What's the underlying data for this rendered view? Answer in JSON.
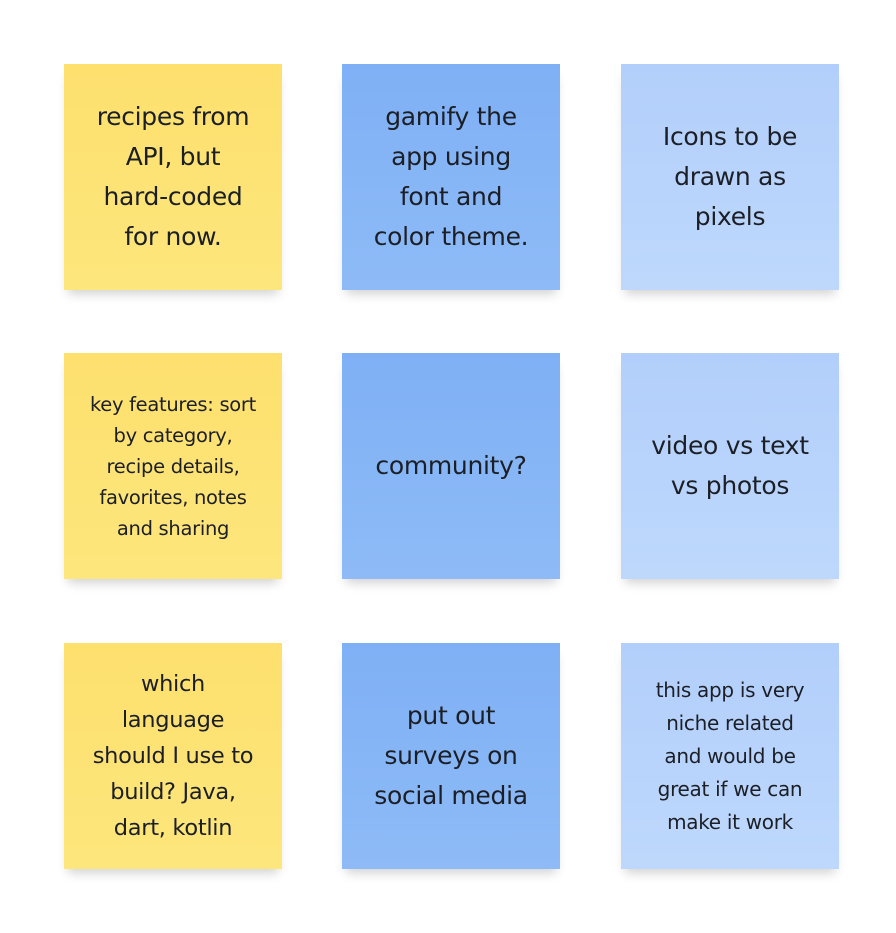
{
  "colors": {
    "yellow": "#fde272",
    "blue": "#86b5f6",
    "light_blue": "#b8d3fb",
    "text": "#1c1f26"
  },
  "notes": [
    {
      "text": "recipes from\nAPI, but\nhard-coded\nfor now.",
      "color": "yellow"
    },
    {
      "text": "gamify the\napp using\nfont and\ncolor theme.",
      "color": "blue"
    },
    {
      "text": "Icons to be\ndrawn as\npixels",
      "color": "light_blue"
    },
    {
      "text": "key features: sort\nby category,\nrecipe details,\nfavorites, notes\nand sharing",
      "color": "yellow"
    },
    {
      "text": "community?",
      "color": "blue"
    },
    {
      "text": "video vs text\nvs photos",
      "color": "light_blue"
    },
    {
      "text": "which\nlanguage\nshould I use to\nbuild? Java,\ndart, kotlin",
      "color": "yellow"
    },
    {
      "text": "put out\nsurveys on\nsocial media",
      "color": "blue"
    },
    {
      "text": "this app is very\nniche related\nand would be\ngreat if we can\nmake it work",
      "color": "light_blue"
    }
  ]
}
